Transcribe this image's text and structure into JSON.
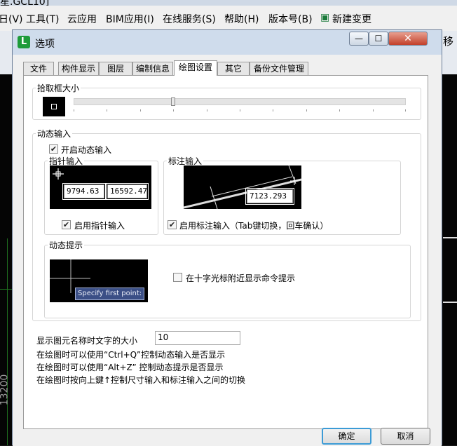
{
  "background_app": {
    "title_fragment": "星.GCL10]",
    "menu": [
      "日(V)",
      "工具(T)",
      "云应用",
      "BIM应用(I)",
      "在线服务(S)",
      "帮助(H)",
      "版本号(B)",
      "新建变更"
    ],
    "right_edge_char": "移",
    "left_dimension": "13200"
  },
  "dialog": {
    "title": "选项",
    "icon_glyph": "L",
    "buttons": {
      "minimize": "—",
      "maximize": "☐",
      "close": "✕"
    },
    "tabs": [
      "文件",
      "构件显示",
      "图层",
      "编制信息",
      "绘图设置",
      "其它",
      "备份文件管理"
    ],
    "active_tab": "绘图设置",
    "pick_box": {
      "label": "拾取框大小",
      "slider_fraction": 0.3
    },
    "dynamic_input": {
      "label": "动态输入",
      "enable_checkbox": {
        "label": "开启动态输入",
        "checked": true
      },
      "pointer_input": {
        "label": "指针输入",
        "value_x": "9794.63",
        "value_y": "16592.475",
        "enable_checkbox": {
          "label": "启用指针输入",
          "checked": true
        }
      },
      "dimension_input": {
        "label": "标注输入",
        "value": "7123.293",
        "enable_checkbox": {
          "label": "启用标注输入（Tab键切换，回车确认）",
          "checked": true
        }
      }
    },
    "dynamic_prompt": {
      "label": "动态提示",
      "preview_text": "Specify first point:",
      "show_checkbox": {
        "label": "在十字光标附近显示命令提示",
        "checked": false
      }
    },
    "name_text_size": {
      "label": "显示图元名称时文字的大小",
      "value": "10"
    },
    "tips": [
      "在绘图时可以使用“Ctrl+Q”控制动态输入是否显示",
      "在绘图时可以使用“Alt+Z” 控制动态提示是否显示",
      "在绘图时按向上鍵↑控制尺寸输入和标注输入之间的切换"
    ],
    "ok_label": "确定",
    "cancel_label": "取消"
  }
}
